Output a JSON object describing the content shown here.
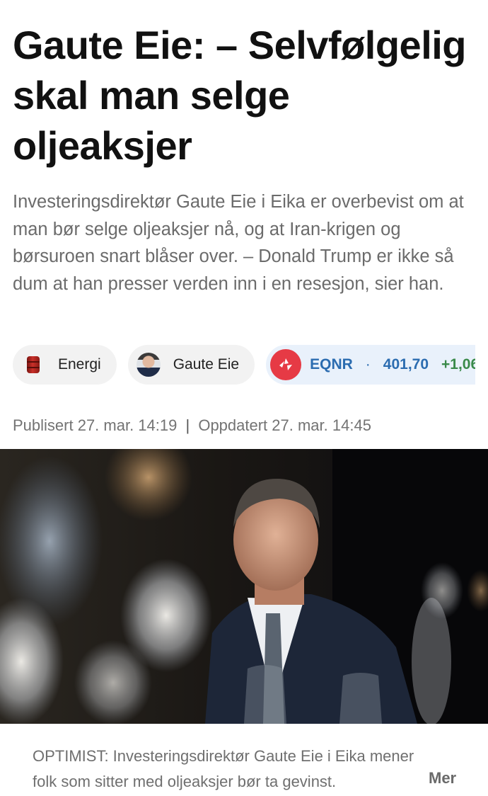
{
  "article": {
    "headline": "Gaute Eie: – Selvfølgelig skal man selge oljeaksjer",
    "lede": "Investeringsdirektør Gaute Eie i Eika er overbevist om at man bør selge oljeaksjer nå, og at Iran-krigen og børsuroen snart blåser over. – Donald Trump er ikke så dum at han presser verden inn i en resesjon, sier han."
  },
  "tags": {
    "energy": {
      "label": "Energi",
      "icon": "oil-barrel-icon"
    },
    "person": {
      "label": "Gaute Eie",
      "icon": "avatar"
    },
    "stock": {
      "ticker": "EQNR",
      "separator": "·",
      "price": "401,70",
      "change": "+1,06",
      "logo_color": "#e63a45",
      "price_color": "#2b6cb0",
      "change_color": "#3a8a4a"
    }
  },
  "meta": {
    "published": "Publisert 27. mar. 14:19",
    "separator": "|",
    "updated": "Oppdatert 27. mar. 14:45"
  },
  "caption": {
    "text": "OPTIMIST: Investeringsdirektør Gaute Eie i Eika mener folk som sitter med oljeaksjer bør ta gevinst.",
    "more_label": "Mer"
  }
}
